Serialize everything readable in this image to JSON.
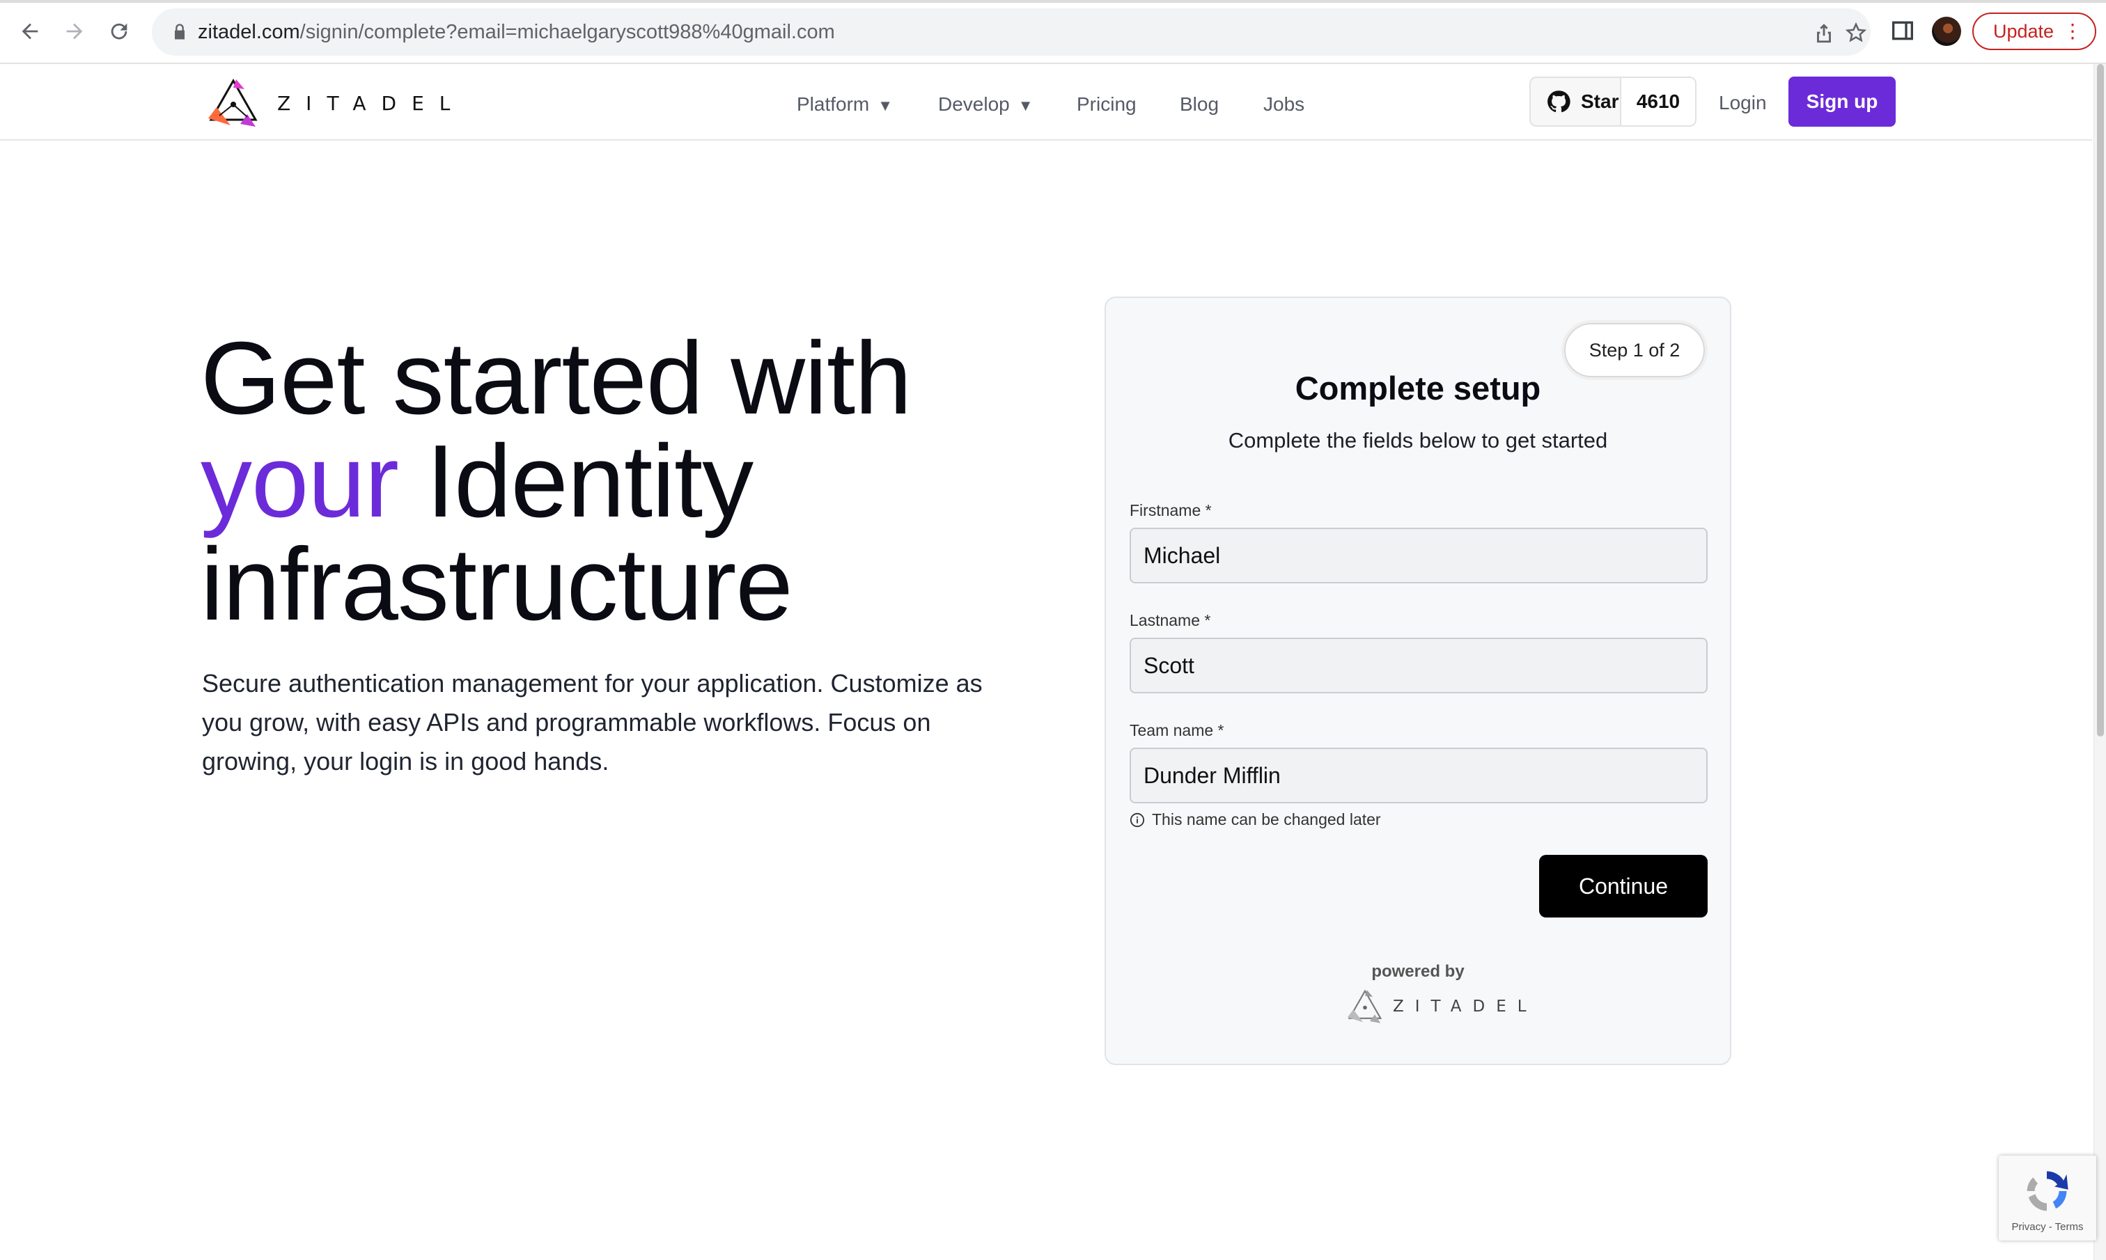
{
  "browser": {
    "url_host": "zitadel.com",
    "url_path": "/signin/complete?email=michaelgaryscott988%40gmail.com",
    "update_label": "Update",
    "icons": [
      "back-arrow-icon",
      "forward-arrow-icon",
      "reload-icon",
      "lock-icon",
      "share-icon",
      "star-icon",
      "side-panel-icon",
      "profile-avatar",
      "kebab-menu-icon"
    ]
  },
  "header": {
    "logo_text": "ZITADEL",
    "menu": [
      {
        "label": "Platform",
        "caret": "▼"
      },
      {
        "label": "Develop",
        "caret": "▼"
      },
      {
        "label": "Pricing"
      },
      {
        "label": "Blog"
      },
      {
        "label": "Jobs"
      }
    ],
    "github_star_label": "Star",
    "github_star_count": "4610",
    "login_label": "Login",
    "signup_label": "Sign up"
  },
  "hero": {
    "title_line1": "Get started with",
    "title_accent": "your",
    "title_line2_rest": " Identity",
    "title_line3": "infrastructure",
    "subtitle": "Secure authentication management for your application. Customize as you grow, with easy APIs and programmable workflows. Focus on growing, your login is in good hands."
  },
  "setup": {
    "step": "Step 1 of 2",
    "title": "Complete setup",
    "subtitle": "Complete the fields below to get started",
    "fields": [
      {
        "label": "Firstname *",
        "value": "Michael"
      },
      {
        "label": "Lastname *",
        "value": "Scott"
      },
      {
        "label": "Team name *",
        "value": "Dunder Mifflin"
      }
    ],
    "hint": "This name can be changed later",
    "continue_label": "Continue",
    "powered_by": "powered by",
    "powered_logo_text": "ZITADEL"
  },
  "recaptcha": {
    "terms": "Privacy - Terms"
  },
  "colors": {
    "accent": "#6c2bd9",
    "button_dark": "#000000",
    "update_red": "#c5221f"
  }
}
